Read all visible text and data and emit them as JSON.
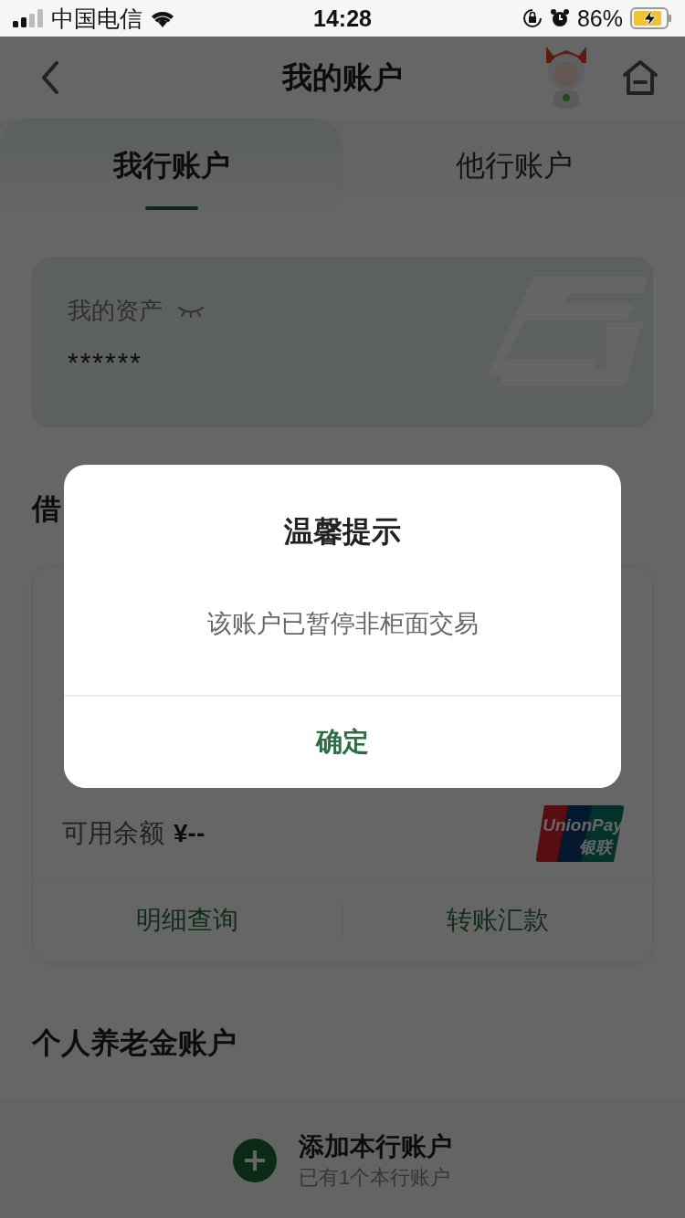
{
  "status_bar": {
    "carrier": "中国电信",
    "time": "14:28",
    "battery": "86%"
  },
  "header": {
    "title": "我的账户"
  },
  "tabs": [
    {
      "label": "我行账户",
      "selected": true
    },
    {
      "label": "他行账户",
      "selected": false
    }
  ],
  "assets": {
    "label": "我的资产",
    "value": "******"
  },
  "debit_section": {
    "title": "借"
  },
  "account_card": {
    "balance_label": "可用余额",
    "balance": "¥--",
    "card_logo": [
      "UnionPay",
      "银联"
    ],
    "actions": [
      "明细查询",
      "转账汇款"
    ]
  },
  "pension_section": {
    "title": "个人养老金账户"
  },
  "add_account": {
    "label": "添加本行账户",
    "subtitle": "已有1个本行账户"
  },
  "dialog": {
    "title": "温馨提示",
    "message": "该账户已暂停非柜面交易",
    "confirm": "确定"
  }
}
